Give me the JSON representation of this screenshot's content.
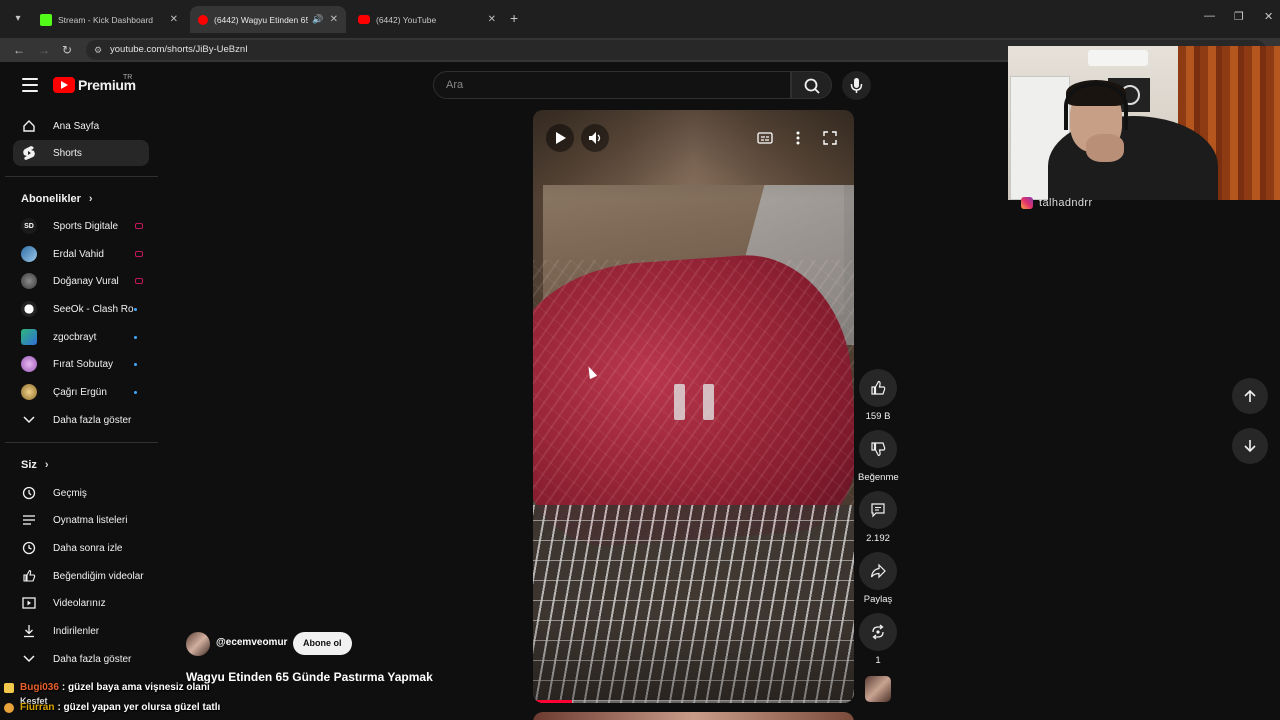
{
  "browser": {
    "tabs": [
      {
        "title": "Stream - Kick Dashboard",
        "active": false,
        "favicon_color": "#53fc18"
      },
      {
        "title": "(6442) Wagyu Etinden 65 G",
        "active": true,
        "favicon_color": "#ff0000"
      },
      {
        "title": "(6442) YouTube",
        "active": false,
        "favicon_color": "#ff0000"
      }
    ],
    "url": "youtube.com/shorts/JiBy-UeBznI"
  },
  "youtube": {
    "logo_text": "Premium",
    "logo_region": "TR",
    "search_placeholder": "Ara",
    "sidebar": {
      "main": [
        {
          "label": "Ana Sayfa",
          "icon": "home-icon",
          "active": false
        },
        {
          "label": "Shorts",
          "icon": "shorts-icon",
          "active": true
        }
      ],
      "subscriptions_heading": "Abonelikler",
      "subscriptions": [
        {
          "label": "Sports Digitale",
          "indicator": "live",
          "avatar_color": "#1b1b1b"
        },
        {
          "label": "Erdal Vahid",
          "indicator": "live",
          "avatar_color": "#2f6fa8"
        },
        {
          "label": "Doğanay Vural",
          "indicator": "live",
          "avatar_color": "#5a5a5a"
        },
        {
          "label": "SeeOk - Clash Ro...",
          "indicator": "dot",
          "avatar_color": "#e9e9e9"
        },
        {
          "label": "zgocbrayt",
          "indicator": "dot",
          "avatar_color": "#2fb67a"
        },
        {
          "label": "Fırat Sobutay",
          "indicator": "dot",
          "avatar_color": "#9b59b6"
        },
        {
          "label": "Çağrı Ergün",
          "indicator": "dot",
          "avatar_color": "#c8a050"
        }
      ],
      "show_more": "Daha fazla göster",
      "you_heading": "Siz",
      "you_items": [
        {
          "label": "Geçmiş",
          "icon": "history-icon"
        },
        {
          "label": "Oynatma listeleri",
          "icon": "playlist-icon"
        },
        {
          "label": "Daha sonra izle",
          "icon": "clock-icon"
        },
        {
          "label": "Beğendiğim videolar",
          "icon": "thumbs-up-icon"
        },
        {
          "label": "Videolarınız",
          "icon": "video-icon"
        },
        {
          "label": "İndirilenler",
          "icon": "download-icon"
        }
      ],
      "show_more_2": "Daha fazla göster"
    },
    "short": {
      "channel": "@ecemveomur",
      "subscribe_label": "Abone ol",
      "title": "Wagyu Etinden 65 Günde Pastırma Yapmak",
      "progress_fraction": 0.12,
      "actions": {
        "likes": "159 B",
        "dislike_label": "Beğenme",
        "comments": "2.192",
        "share_label": "Paylaş",
        "remix_count": "1"
      }
    }
  },
  "overlay": {
    "social_handle": "talhadndrr",
    "chat": [
      {
        "user": "Bugi036",
        "message": ": güzel baya ama vişnesiz olanı"
      },
      {
        "user": "Fiurran",
        "message": ": güzel yapan yer olursa güzel tatlı"
      }
    ],
    "chat_ghost": "Kesfet"
  }
}
